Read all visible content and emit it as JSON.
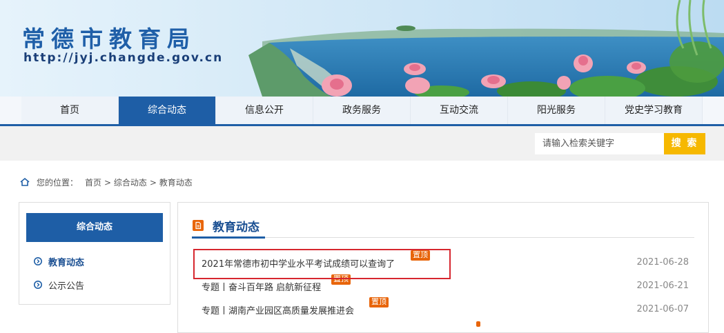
{
  "header": {
    "site_title": "常德市教育局",
    "site_url": "http://jyj.changde.gov.cn"
  },
  "nav": {
    "items": [
      {
        "label": "首页",
        "active": false
      },
      {
        "label": "综合动态",
        "active": true
      },
      {
        "label": "信息公开",
        "active": false
      },
      {
        "label": "政务服务",
        "active": false
      },
      {
        "label": "互动交流",
        "active": false
      },
      {
        "label": "阳光服务",
        "active": false
      },
      {
        "label": "党史学习教育",
        "active": false
      }
    ]
  },
  "search": {
    "placeholder": "请输入检索关键字",
    "button_label": "搜 索"
  },
  "breadcrumb": {
    "prefix": "您的位置：",
    "items": [
      "首页",
      "> 综合动态",
      "> 教育动态"
    ]
  },
  "sidebar": {
    "heading": "综合动态",
    "items": [
      {
        "label": "教育动态",
        "active": true
      },
      {
        "label": "公示公告",
        "active": false
      }
    ]
  },
  "main": {
    "section_title": "教育动态",
    "news": [
      {
        "title": "2021年常德市初中学业水平考试成绩可以查询了",
        "badge": "置顶",
        "date": "2021-06-28",
        "highlighted": true
      },
      {
        "title": "专题丨奋斗百年路 启航新征程",
        "badge": "置顶",
        "date": "2021-06-21",
        "highlighted": false
      },
      {
        "title": "专题丨湖南产业园区高质量发展推进会",
        "badge": "置顶",
        "date": "2021-06-07",
        "highlighted": false
      }
    ]
  },
  "colors": {
    "brand_blue": "#1e5ea6",
    "search_yellow": "#f6b800",
    "badge_orange": "#e8650a",
    "highlight_red": "#d6262e"
  }
}
